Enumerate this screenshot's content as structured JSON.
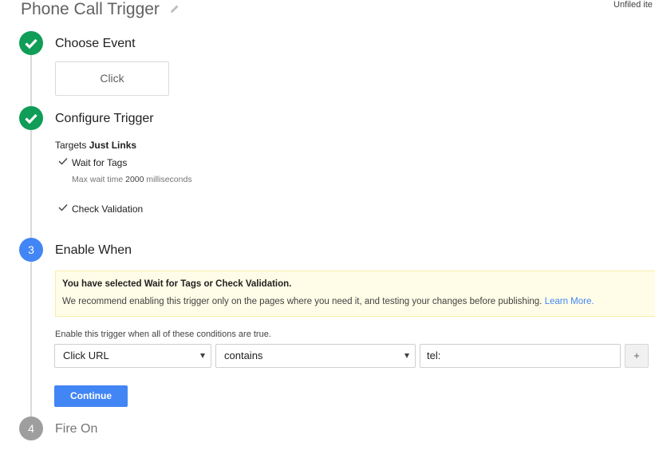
{
  "header": {
    "title": "Phone Call Trigger",
    "folder_label": "Unfiled ite"
  },
  "steps": [
    {
      "number": "",
      "title": "Choose Event",
      "state": "done"
    },
    {
      "number": "",
      "title": "Configure Trigger",
      "state": "done"
    },
    {
      "number": "3",
      "title": "Enable When",
      "state": "current"
    },
    {
      "number": "4",
      "title": "Fire On",
      "state": "pending"
    }
  ],
  "event": {
    "label": "Click"
  },
  "configure": {
    "targets_prefix": "Targets",
    "targets_value": "Just Links",
    "wait_for_tags": "Wait for Tags",
    "max_wait_prefix": "Max wait time",
    "max_wait_value": "2000",
    "max_wait_suffix": "milliseconds",
    "check_validation": "Check Validation"
  },
  "notice": {
    "title": "You have selected Wait for Tags or Check Validation.",
    "body": "We recommend enabling this trigger only on the pages where you need it, and testing your changes before publishing.",
    "link": "Learn More."
  },
  "conditions": {
    "label": "Enable this trigger when all of these conditions are true.",
    "variable": "Click URL",
    "operator": "contains",
    "value": "tel:",
    "add_label": "+"
  },
  "actions": {
    "continue_label": "Continue"
  },
  "colors": {
    "done": "#0f9d58",
    "current": "#4285f4",
    "pending": "#9e9e9e",
    "link": "#4285f4"
  }
}
